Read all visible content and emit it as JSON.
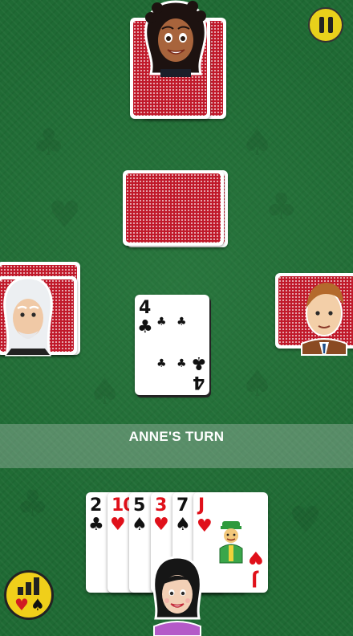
{
  "turn_banner": {
    "text": "ANNE'S TURN"
  },
  "center_card": {
    "rank": "4",
    "suit": "♣",
    "color": "black"
  },
  "hand": [
    {
      "rank": "2",
      "suit": "♣",
      "color": "black"
    },
    {
      "rank": "10",
      "suit": "♥",
      "color": "red"
    },
    {
      "rank": "5",
      "suit": "♠",
      "color": "black"
    },
    {
      "rank": "3",
      "suit": "♥",
      "color": "red"
    },
    {
      "rank": "7",
      "suit": "♠",
      "color": "black"
    },
    {
      "rank": "J",
      "suit": "♥",
      "color": "red"
    }
  ],
  "icons": {
    "pause": "pause-icon",
    "stats": "stats-icon",
    "hearts_suit": "♥",
    "spades_suit": "♠"
  },
  "colors": {
    "felt": "#1f6a34",
    "card_back": "#c0192a",
    "button_yellow": "#e8d11b"
  }
}
